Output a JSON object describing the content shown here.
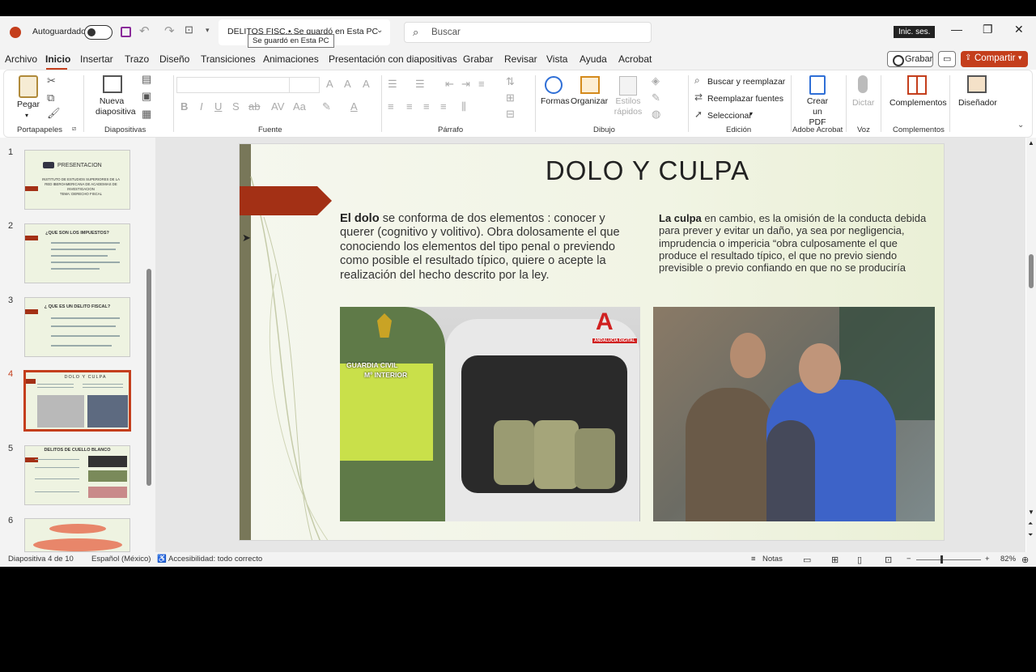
{
  "titlebar": {
    "autosave_label": "Autoguardado",
    "document_name": "DELITOS FISC...",
    "save_status": "• Se guardó en Esta PC",
    "tooltip": "Se guardó en Esta PC",
    "search_placeholder": "Buscar",
    "signin_label": "Inic. ses."
  },
  "menu": {
    "items": [
      "Archivo",
      "Inicio",
      "Insertar",
      "Trazo",
      "Diseño",
      "Transiciones",
      "Animaciones",
      "Presentación con diapositivas",
      "Grabar",
      "Revisar",
      "Vista",
      "Ayuda",
      "Acrobat"
    ],
    "active": "Inicio",
    "record_button": "Grabar",
    "share_button": "Compartir"
  },
  "ribbon": {
    "paste": "Pegar",
    "portapapeles": "Portapapeles",
    "new_slide": "Nueva diapositiva",
    "diapositivas": "Diapositivas",
    "fuente": "Fuente",
    "parrafo": "Párrafo",
    "formas": "Formas",
    "organizar": "Organizar",
    "estilos": "Estilos rápidos",
    "dibujo": "Dibujo",
    "find_replace": "Buscar y reemplazar",
    "replace_fonts": "Reemplazar fuentes",
    "select": "Seleccionar",
    "edicion": "Edición",
    "create_pdf": "Crear un PDF",
    "adobe": "Adobe Acrobat",
    "dictate": "Dictar",
    "voz": "Voz",
    "addins": "Complementos",
    "addins_group": "Complementos",
    "designer": "Diseñador"
  },
  "thumbnails": [
    {
      "num": "1",
      "title": "PRESENTACION",
      "lines": [
        "INSTITUTO DE ESTUDIOS SUPERIORES DE LA",
        "RED IBEROAMERICANA DE ACADEMIAS DE",
        "INVESTIGACION",
        "TEMA: DERECHO FISCAL"
      ]
    },
    {
      "num": "2",
      "title": "¿QUE SON LOS IMPUESTOS?"
    },
    {
      "num": "3",
      "title": "¿ QUE ES UN DELITO FISCAL?"
    },
    {
      "num": "4",
      "title": "DOLO Y CULPA"
    },
    {
      "num": "5",
      "title": "DELITOS DE CUELLO BLANCO"
    },
    {
      "num": "6",
      "title": ""
    }
  ],
  "slide": {
    "title": "DOLO Y CULPA",
    "dolo_bold": "El dolo",
    "dolo_rest": " se conforma de dos elementos : conocer y querer (cognitivo y volitivo). Obra dolosamente el que conociendo los elementos del tipo penal o previendo como posible el resultado típico, quiere o acepte la realización del hecho descrito por la ley.",
    "culpa_bold": "La culpa",
    "culpa_rest": " en cambio, es la omisión de la conducta debida para prever y evitar un daño, ya sea por negligencia, imprudencia o impericia “obra culposamente el que produce el resultado típico, el que no previo siendo previsible o previo confiando en que no se produciría",
    "img1_logo": "A",
    "img1_logo_text": "ANDALUCÍA DIGITAL",
    "img1_caption1": "GUARDIA CIVIL",
    "img1_caption2": "Mº INTERIOR"
  },
  "status": {
    "slide_info": "Diapositiva 4 de 10",
    "language": "Español (México)",
    "accessibility": "Accesibilidad: todo correcto",
    "notes": "Notas",
    "zoom": "82%"
  },
  "colors": {
    "accent": "#c43e1c",
    "slide_arrow": "#a33015",
    "slide_bar": "#787759"
  }
}
